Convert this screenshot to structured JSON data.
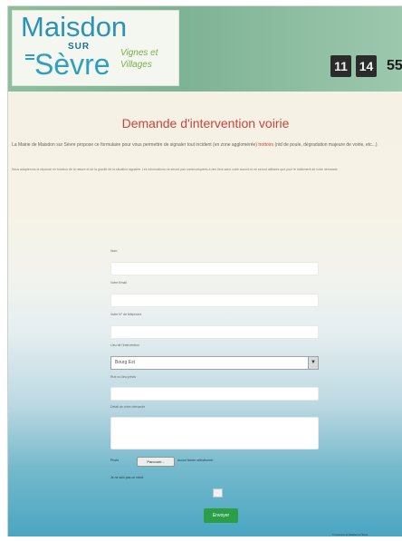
{
  "header": {
    "logo": {
      "name_top": "Maisdon",
      "name_mid": "SUR",
      "name_bottom": "Sèvre",
      "tagline": "Vignes et Villages"
    },
    "clock": {
      "hours": "11",
      "minutes": "14",
      "seconds": "55"
    }
  },
  "page": {
    "title": "Demande d'intervention voirie",
    "intro_text": "La Mairie de Maisdon sur Sèvre propose ce formulaire pour vous permettre de signaler tout incident (en zone agglomérée)",
    "intro_link": "trottoirs",
    "intro_rest": "(nid de poule, dégradation majeure de voirie, etc...)",
    "notice": "Nous adapterons la réponse en fonction de la nature et de la gravité de la situation signalée. Les informations ne seront pas communiquées à des tiers sans votre accord et ne seront utilisées que pour le traitement de votre demande."
  },
  "form": {
    "fields": [
      {
        "label": "Nom"
      },
      {
        "label": "Votre Email"
      },
      {
        "label": "Votre N° de téléphone"
      }
    ],
    "location_label": "Lieu de l'intervention",
    "location_value": "Bourg Est",
    "address_label": "Rue ou lieu précis",
    "details_label": "Détail de votre demande",
    "file_label": "Photo",
    "file_button": "Parcourir...",
    "file_status": "Aucun fichier sélectionné.",
    "captcha_label": "Je ne suis pas un robot",
    "submit_label": "Envoyer"
  },
  "footer": {
    "text": "© Commune de Maisdon sur Sèvre"
  }
}
